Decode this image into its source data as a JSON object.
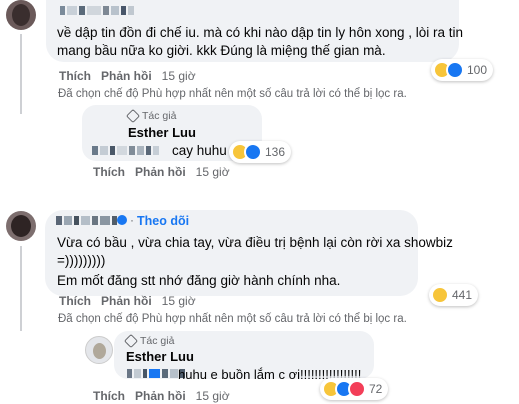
{
  "comments": [
    {
      "text_lines": [
        "về dập tin đồn đi chế iu. mà có khi nào dập tin ly hôn xong , lòi ra tin",
        "mang bầu nữa ko giời. kkk Đúng là miệng thế gian mà."
      ],
      "reaction_count": "100",
      "reactions": [
        "haha-icon",
        "like-icon"
      ],
      "actions": {
        "like": "Thích",
        "reply": "Phản hồi",
        "time": "15 giờ"
      },
      "filter_note": "Đã chọn chế độ Phù hợp nhất nên một số câu trả lời có thể bị lọc ra."
    },
    {
      "follow_label": "Theo dõi",
      "text_lines": [
        "Vừa có bầu , vừa chia tay, vừa điều trị bệnh lại còn rời xa showbiz",
        "=)))))))))",
        "Em mốt đăng stt nhớ đăng giờ hành chính nha."
      ],
      "reaction_count": "441",
      "reactions": [
        "haha-icon"
      ],
      "actions": {
        "like": "Thích",
        "reply": "Phản hồi",
        "time": "15 giờ"
      },
      "filter_note": "Đã chọn chế độ Phù hợp nhất nên một số câu trả lời có thể bị lọc ra."
    }
  ],
  "replies": [
    {
      "author_tag": "Tác giả",
      "author_name": "Esther Luu",
      "text": "cay huhu",
      "reaction_count": "136",
      "reactions": [
        "haha-icon",
        "like-icon"
      ],
      "actions": {
        "like": "Thích",
        "reply": "Phản hồi",
        "time": "15 giờ"
      }
    },
    {
      "author_tag": "Tác giả",
      "author_name": "Esther Luu",
      "text": "huhu e buồn lắm c ơi!!!!!!!!!!!!!!!!!",
      "reaction_count": "72",
      "reactions": [
        "haha-icon",
        "like-icon",
        "love-icon"
      ],
      "actions": {
        "like": "Thích",
        "reply": "Phản hồi",
        "time": "15 giờ"
      }
    }
  ],
  "colors": {
    "bubble": "#f0f2f5",
    "meta_text": "#65676b",
    "link_blue": "#1877f2"
  }
}
